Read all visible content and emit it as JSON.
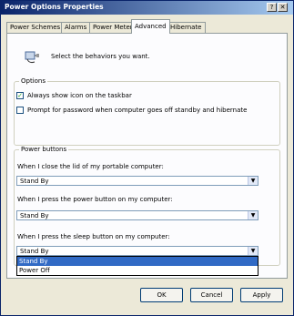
{
  "window": {
    "title": "Power Options Properties",
    "help_label": "?",
    "close_label": "✕"
  },
  "tabs": [
    {
      "label": "Power Schemes"
    },
    {
      "label": "Alarms"
    },
    {
      "label": "Power Meter"
    },
    {
      "label": "Advanced",
      "active": true
    },
    {
      "label": "Hibernate"
    }
  ],
  "header": {
    "icon": "power-plug-icon",
    "text": "Select the behaviors you want."
  },
  "options": {
    "legend": "Options",
    "items": [
      {
        "label": "Always show icon on the taskbar",
        "checked": true
      },
      {
        "label": "Prompt for password when computer goes off standby and hibernate",
        "checked": false
      }
    ]
  },
  "power_buttons": {
    "legend": "Power buttons",
    "lid_label": "When I close the lid of my portable computer:",
    "lid_value": "Stand By",
    "power_label": "When I press the power button on my computer:",
    "power_value": "Stand By",
    "sleep_label": "When I press the sleep button on my computer:",
    "sleep_value": "Stand By",
    "sleep_options": [
      {
        "label": "Stand By",
        "selected": true
      },
      {
        "label": "Power Off",
        "selected": false
      }
    ]
  },
  "buttons": {
    "ok": "OK",
    "cancel": "Cancel",
    "apply": "Apply"
  }
}
